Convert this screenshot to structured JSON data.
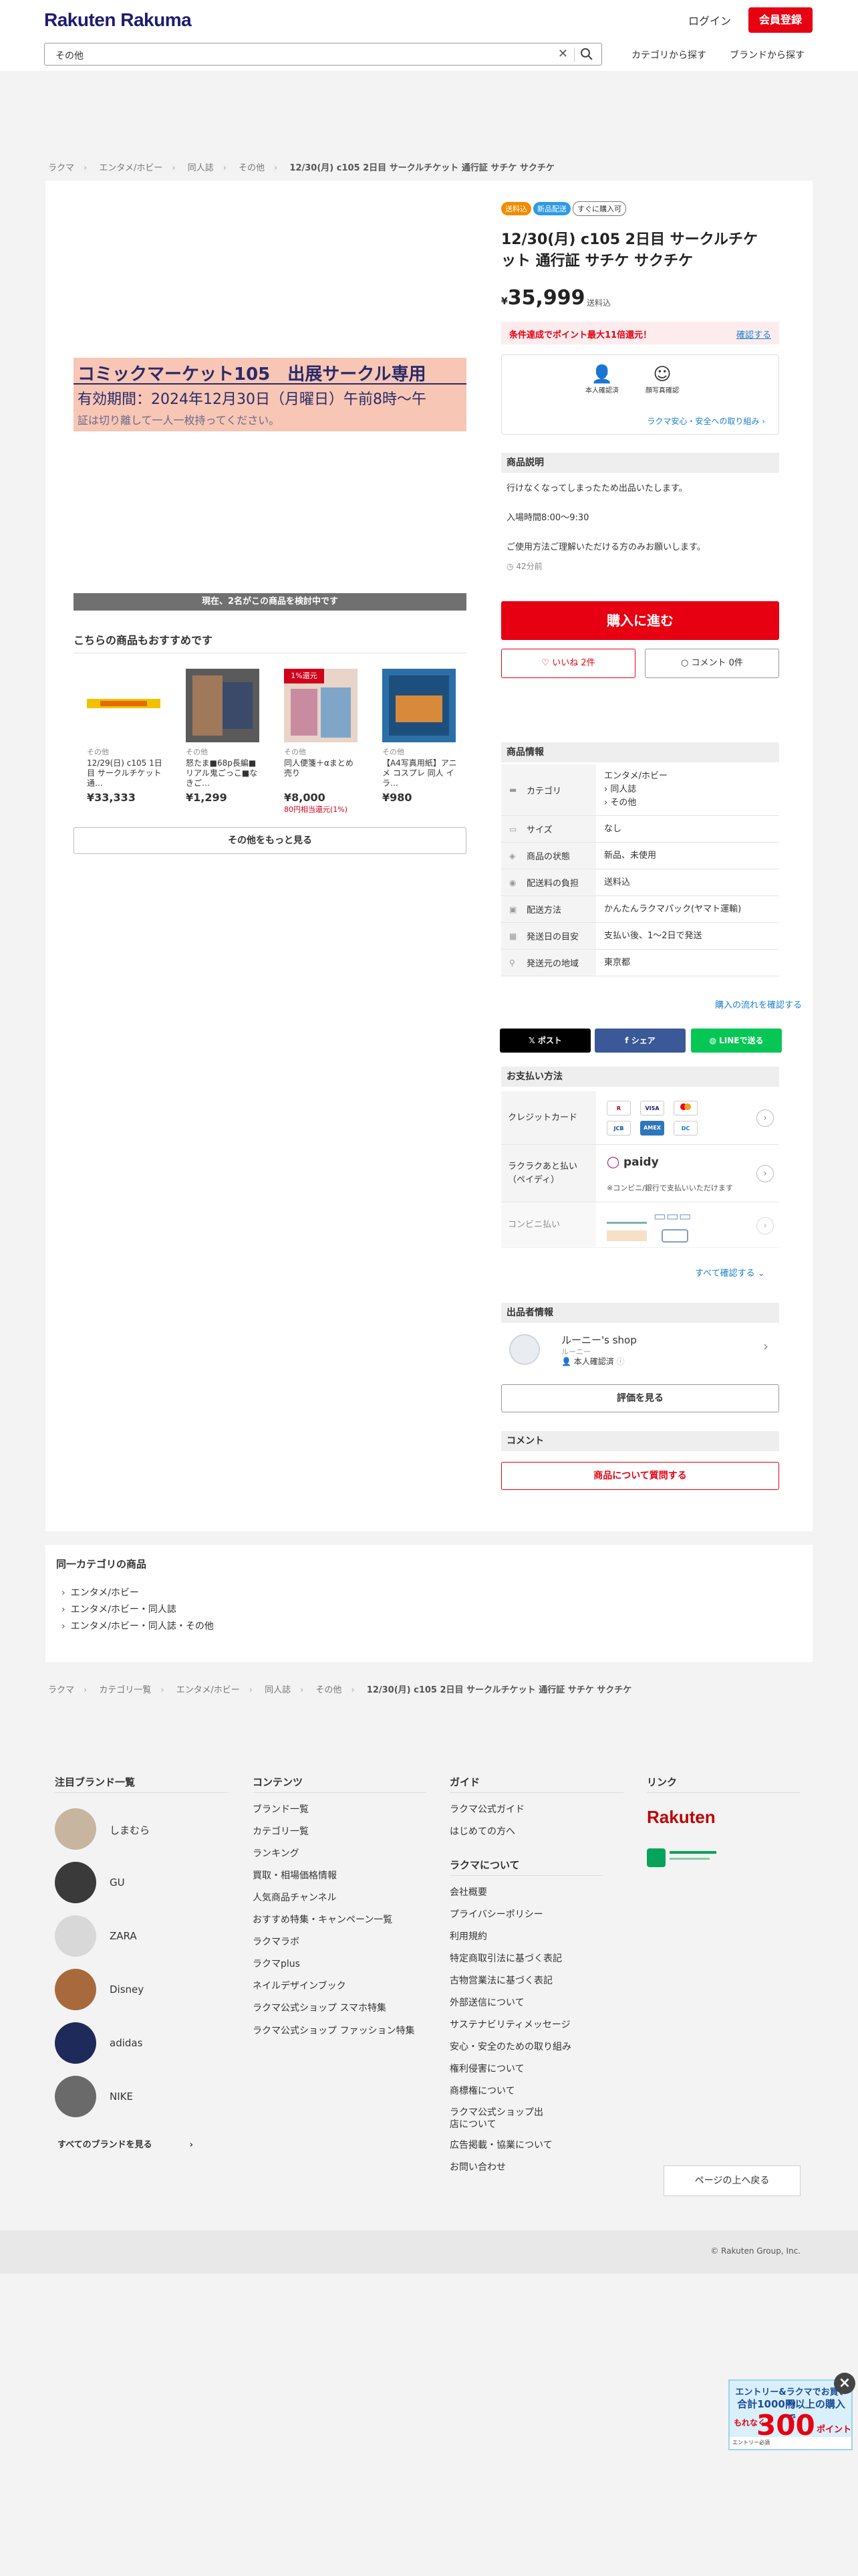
{
  "header": {
    "logo_a": "Rakuten",
    "logo_b": "Rakuma",
    "login": "ログイン",
    "register": "会員登録",
    "search_value": "その他",
    "by_category": "カテゴリから探す",
    "by_brand": "ブランドから探す"
  },
  "breadcrumb": [
    "ラクマ",
    "エンタメ/ホビー",
    "同人誌",
    "その他",
    "12/30(月) c105 2日目 サークルチケット 通行証 サチケ サクチケ"
  ],
  "photo": {
    "line1": "コミックマーケット105　出展サークル専用",
    "line2": "有効期間：2024年12月30日（月曜日）午前8時〜午",
    "line3": "証は切り離して一人一枚持ってください。"
  },
  "viewing": "現在、2名がこの商品を検討中です",
  "recommend": {
    "title": "こちらの商品もおすすめです",
    "items": [
      {
        "cat": "その他",
        "name": "12/29(日) c105 1日目 サークルチケット 通…",
        "price": "¥33,333",
        "points": ""
      },
      {
        "cat": "その他",
        "name": "怒たま■68p長編■リアル鬼ごっこ■なきご…",
        "price": "¥1,299",
        "points": ""
      },
      {
        "cat": "その他",
        "name": "同人便箋＋αまとめ売り",
        "price": "¥8,000",
        "points": "80円相当還元(1%)"
      },
      {
        "cat": "その他",
        "name": "【A4写真用紙】アニメ コスプレ 同人 イラ…",
        "price": "¥980",
        "points": ""
      }
    ],
    "badge_1pct": "1%還元",
    "more": "その他をもっと見る"
  },
  "item": {
    "badges": [
      "送料込",
      "新品配送",
      "すぐに購入可"
    ],
    "title": "12/30(月) c105 2日目 サークルチケット 通行証 サチケ サクチケ",
    "price_yen": "¥",
    "price": "35,999",
    "shipping": "送料込",
    "campaign": "条件達成でポイント最大11倍還元！",
    "campaign_link": "確認する",
    "safe1": "本人確認済",
    "safe2": "顔写真確認",
    "safe_link": "ラクマ安心・安全への取り組み",
    "desc_heading": "商品説明",
    "desc": [
      "行けなくなってしまったため出品いたします。",
      "入場時間8:00〜9:30",
      "ご使用方法ご理解いただける方のみお願いします。"
    ],
    "age": "42分前",
    "buy": "購入に進む",
    "like": "いいね 2件",
    "comment": "コメント 0件"
  },
  "info": {
    "heading": "商品情報",
    "rows": [
      {
        "k": "カテゴリ",
        "v": "エンタメ/ホビー\n› 同人誌\n› その他"
      },
      {
        "k": "サイズ",
        "v": "なし"
      },
      {
        "k": "商品の状態",
        "v": "新品、未使用"
      },
      {
        "k": "配送料の負担",
        "v": "送料込"
      },
      {
        "k": "配送方法",
        "v": "かんたんラクマパック(ヤマト運輸)"
      },
      {
        "k": "発送日の目安",
        "v": "支払い後、1〜2日で発送"
      },
      {
        "k": "発送元の地域",
        "v": "東京都"
      }
    ],
    "flow_link": "購入の流れを確認する"
  },
  "share": {
    "x": "ポスト",
    "fb": "シェア",
    "line": "LINEで送る"
  },
  "payment": {
    "heading": "お支払い方法",
    "credit": "クレジットカード",
    "paidy": "ラクラクあと払い（ペイディ）",
    "paidy_note": "※コンビニ/銀行で支払いいただけます",
    "conv": "コンビニ払い",
    "see_all": "すべて確認する"
  },
  "seller": {
    "heading": "出品者情報",
    "name": "ルーニー's shop",
    "sub": "ルーニー",
    "verified": "本人確認済",
    "rating": "評価を見る"
  },
  "comment": {
    "heading": "コメント",
    "ask": "商品について質問する"
  },
  "same_category": {
    "heading": "同一カテゴリの商品",
    "items": [
      "エンタメ/ホビー",
      "エンタメ/ホビー・同人誌",
      "エンタメ/ホビー・同人誌・その他"
    ]
  },
  "breadcrumb2": [
    "ラクマ",
    "カテゴリ一覧",
    "エンタメ/ホビー",
    "同人誌",
    "その他",
    "12/30(月) c105 2日目 サークルチケット 通行証 サチケ サクチケ"
  ],
  "footer": {
    "brands_heading": "注目ブランド一覧",
    "brands": [
      "しまむら",
      "GU",
      "ZARA",
      "Disney",
      "adidas",
      "NIKE"
    ],
    "all_brands": "すべてのブランドを見る",
    "contents_heading": "コンテンツ",
    "contents": [
      "ブランド一覧",
      "カテゴリ一覧",
      "ランキング",
      "買取・相場価格情報",
      "人気商品チャンネル",
      "おすすめ特集・キャンペーン一覧",
      "ラクマラボ",
      "ラクマplus",
      "ネイルデザインブック",
      "ラクマ公式ショップ スマホ特集",
      "ラクマ公式ショップ ファッション特集"
    ],
    "guide_heading": "ガイド",
    "guide": [
      "ラクマ公式ガイド",
      "はじめての方へ"
    ],
    "about_heading": "ラクマについて",
    "about": [
      "会社概要",
      "プライバシーポリシー",
      "利用規約",
      "特定商取引法に基づく表記",
      "古物営業法に基づく表記",
      "外部送信について",
      "サステナビリティメッセージ",
      "安心・安全のための取り組み",
      "権利侵害について",
      "商標権について",
      "ラクマ公式ショップ出店について",
      "広告掲載・協業について",
      "お問い合わせ"
    ],
    "links_heading": "リンク",
    "rakuten": "Rakuten",
    "pagetop": "ページの上へ戻る",
    "copyright": "© Rakuten Group, Inc."
  },
  "promo": {
    "t1": "エントリー&ラクマでお買い物",
    "t2": "合計1000円以上の購入で",
    "small": "もれなく",
    "big": "300",
    "pt": "ポイント",
    "bottom": "エントリー必須"
  },
  "colors": {
    "brand_red": "#e60012",
    "link_blue": "#1b7fc9",
    "logo_navy": "#1c1c6e"
  }
}
